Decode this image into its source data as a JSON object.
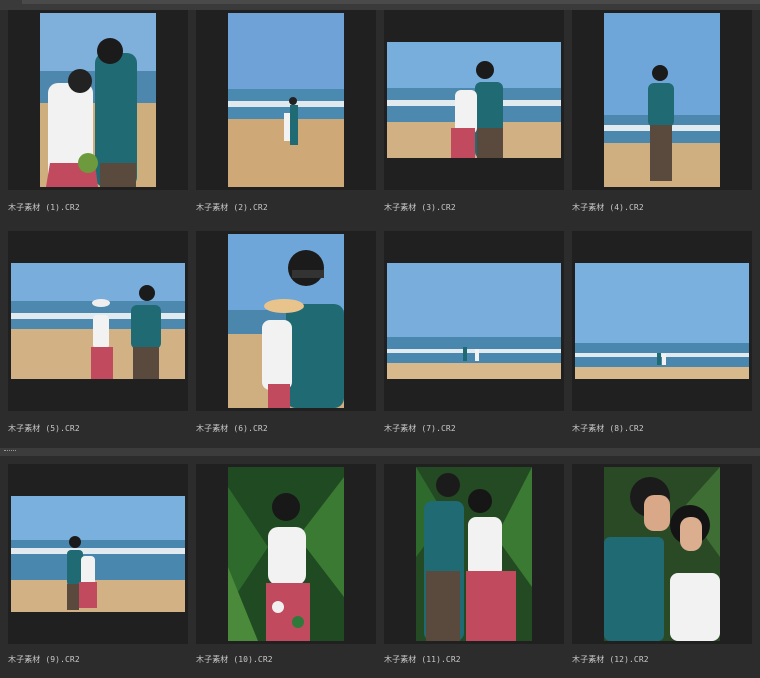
{
  "palette": {
    "bg": "#2c2c2c",
    "frame": "#202020",
    "label": "#c9c9c9",
    "sky": "#6fa3d8",
    "sea": "#3f7faa",
    "sand": "#cfae7e",
    "foliage": "#2d5e2a",
    "shirt_teal": "#1f6a73"
  },
  "files": [
    {
      "name": "木子素材 (1).CR2",
      "orientation": "portrait",
      "scene": "beach-couple-closeup"
    },
    {
      "name": "木子素材 (2).CR2",
      "orientation": "portrait",
      "scene": "beach-couple-wide"
    },
    {
      "name": "木子素材 (3).CR2",
      "orientation": "landscape",
      "scene": "beach-couple-embrace"
    },
    {
      "name": "木子素材 (4).CR2",
      "orientation": "portrait",
      "scene": "beach-man-walking"
    },
    {
      "name": "木子素材 (5).CR2",
      "orientation": "landscape",
      "scene": "beach-couple-standing"
    },
    {
      "name": "木子素材 (6).CR2",
      "orientation": "portrait",
      "scene": "beach-couple-sunglasses"
    },
    {
      "name": "木子素材 (7).CR2",
      "orientation": "landscape",
      "scene": "beach-tiny-couple"
    },
    {
      "name": "木子素材 (8).CR2",
      "orientation": "landscape",
      "scene": "beach-tiny-couple-right"
    },
    {
      "name": "木子素材 (9).CR2",
      "orientation": "landscape",
      "scene": "beach-couple-center"
    },
    {
      "name": "木子素材 (10).CR2",
      "orientation": "portrait",
      "scene": "foliage-woman"
    },
    {
      "name": "木子素材 (11).CR2",
      "orientation": "portrait",
      "scene": "foliage-couple"
    },
    {
      "name": "木子素材 (12).CR2",
      "orientation": "portrait",
      "scene": "foliage-couple-closeup"
    }
  ]
}
